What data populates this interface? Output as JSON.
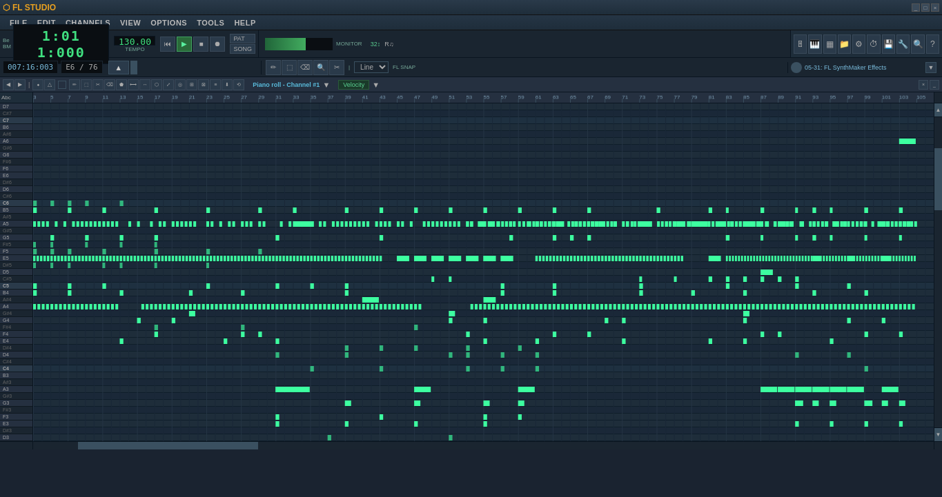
{
  "app": {
    "title": "FL STUDIO",
    "window_controls": [
      "_",
      "□",
      "×"
    ]
  },
  "menu": {
    "items": [
      "FILE",
      "EDIT",
      "CHANNELS",
      "VIEW",
      "OPTIONS",
      "TOOLS",
      "HELP"
    ]
  },
  "transport": {
    "time": "1:01 1:000",
    "bpm": "130.00",
    "beats_top": "Be",
    "beats_bottom": "BM",
    "tempo_label": "TEMPO",
    "pat_label": "PAT",
    "monitor_label": "MONITOR"
  },
  "toolbar": {
    "snap_label": "Line",
    "channel_label": "Piano roll - Channel #1",
    "velocity_label": "Velocity",
    "effects_label": "05-31: FL SynthMaker Effects"
  },
  "piano_roll": {
    "title": "Piano roll - Channel #1",
    "velocity": "Velocity",
    "time_display": "007:16:003",
    "note_display": "E6 / 76"
  },
  "note_keys": [
    {
      "label": "D7",
      "type": "white"
    },
    {
      "label": "C#7",
      "type": "black"
    },
    {
      "label": "C7",
      "type": "white"
    },
    {
      "label": "B6",
      "type": "white"
    },
    {
      "label": "A#6",
      "type": "black"
    },
    {
      "label": "A6",
      "type": "white"
    },
    {
      "label": "G#6",
      "type": "black"
    },
    {
      "label": "G6",
      "type": "white"
    },
    {
      "label": "F#6",
      "type": "black"
    },
    {
      "label": "F6",
      "type": "white"
    },
    {
      "label": "E6",
      "type": "white"
    },
    {
      "label": "D#6",
      "type": "black"
    },
    {
      "label": "D6",
      "type": "white"
    },
    {
      "label": "C#6",
      "type": "black"
    },
    {
      "label": "C6",
      "type": "white"
    },
    {
      "label": "B5",
      "type": "white"
    },
    {
      "label": "A#5",
      "type": "black"
    },
    {
      "label": "A5",
      "type": "white"
    },
    {
      "label": "G#5",
      "type": "black"
    },
    {
      "label": "G5",
      "type": "white"
    },
    {
      "label": "F#5",
      "type": "black"
    },
    {
      "label": "F5",
      "type": "white"
    },
    {
      "label": "E5",
      "type": "white"
    },
    {
      "label": "D#5",
      "type": "black"
    },
    {
      "label": "D5",
      "type": "white"
    },
    {
      "label": "C#5",
      "type": "black"
    },
    {
      "label": "C5",
      "type": "white"
    },
    {
      "label": "B4",
      "type": "white"
    },
    {
      "label": "A#4",
      "type": "black"
    },
    {
      "label": "A4",
      "type": "white"
    },
    {
      "label": "G#4",
      "type": "black"
    },
    {
      "label": "G4",
      "type": "white"
    },
    {
      "label": "F#4",
      "type": "black"
    },
    {
      "label": "F4",
      "type": "white"
    },
    {
      "label": "E4",
      "type": "white"
    },
    {
      "label": "D#4",
      "type": "black"
    },
    {
      "label": "D4",
      "type": "white"
    },
    {
      "label": "C#4",
      "type": "black"
    },
    {
      "label": "C4",
      "type": "white"
    },
    {
      "label": "B3",
      "type": "white"
    },
    {
      "label": "A#3",
      "type": "black"
    },
    {
      "label": "A3",
      "type": "white"
    },
    {
      "label": "G#3",
      "type": "black"
    },
    {
      "label": "G3",
      "type": "white"
    },
    {
      "label": "F#3",
      "type": "black"
    },
    {
      "label": "F3",
      "type": "white"
    },
    {
      "label": "E3",
      "type": "white"
    },
    {
      "label": "D#3",
      "type": "black"
    },
    {
      "label": "D3",
      "type": "white"
    }
  ],
  "colors": {
    "note_green": "#3dffa0",
    "bg_dark": "#1a2330",
    "bg_mid": "#1e2d3a",
    "accent": "#40e080",
    "text_dim": "#888888"
  }
}
